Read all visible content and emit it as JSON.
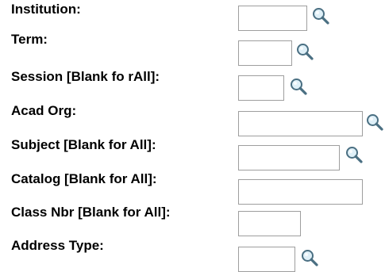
{
  "form": {
    "rows": [
      {
        "label": "Institution:",
        "value": "",
        "has_lookup": true
      },
      {
        "label": "Term:",
        "value": "",
        "has_lookup": true
      },
      {
        "label": "Session [Blank fo rAll]:",
        "value": "",
        "has_lookup": true
      },
      {
        "label": "Acad Org:",
        "value": "",
        "has_lookup": true
      },
      {
        "label": "Subject [Blank for All]:",
        "value": "",
        "has_lookup": true
      },
      {
        "label": "Catalog [Blank for All]:",
        "value": "",
        "has_lookup": false
      },
      {
        "label": "Class Nbr [Blank for All]:",
        "value": "",
        "has_lookup": false
      },
      {
        "label": "Address Type:",
        "value": "",
        "has_lookup": true
      }
    ],
    "lookup_icon": "magnifying-glass-icon"
  }
}
